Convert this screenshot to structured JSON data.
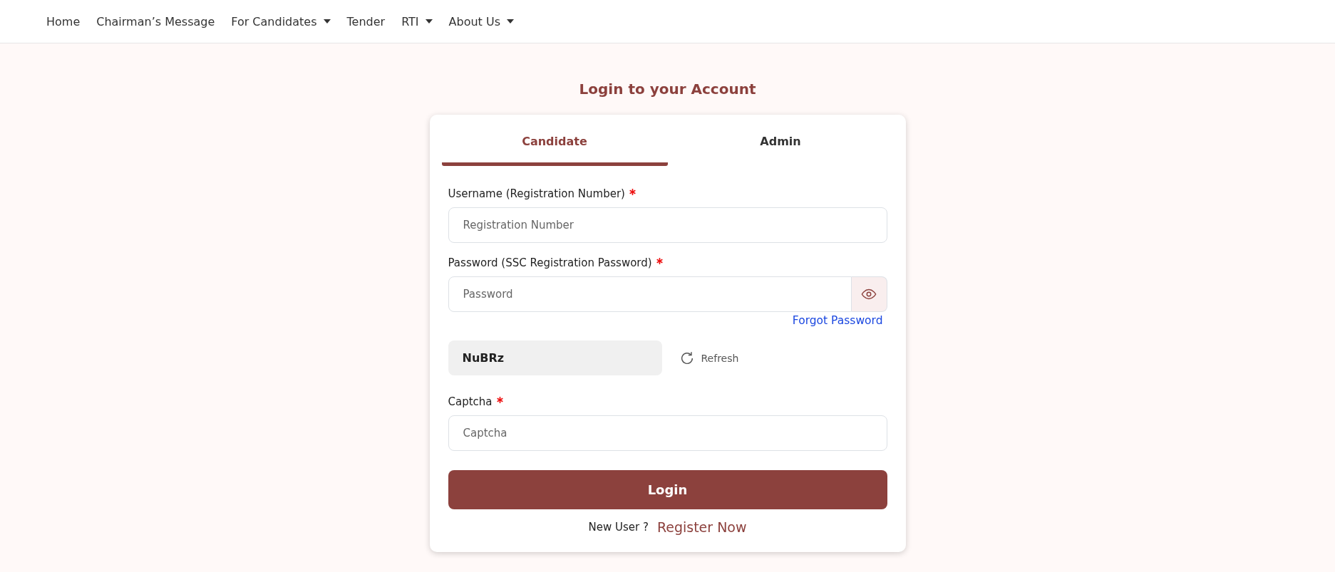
{
  "nav": [
    {
      "label": "Home",
      "dropdown": false
    },
    {
      "label": "Chairman’s Message",
      "dropdown": false
    },
    {
      "label": "For Candidates",
      "dropdown": true
    },
    {
      "label": "Tender",
      "dropdown": false
    },
    {
      "label": "RTI",
      "dropdown": true
    },
    {
      "label": "About Us",
      "dropdown": true
    }
  ],
  "title": "Login to your Account",
  "tabs": [
    {
      "label": "Candidate",
      "selected": true
    },
    {
      "label": "Admin",
      "selected": false
    }
  ],
  "fields": [
    {
      "kind": "text",
      "label": "Username (Registration Number)",
      "required": true,
      "placeholder": "Registration Number"
    },
    {
      "kind": "password",
      "label": "Password (SSC Registration Password)",
      "required": true,
      "placeholder": "Password",
      "link": "Forgot Password"
    },
    {
      "kind": "captcha",
      "code": "NuBRz",
      "action": "Refresh"
    },
    {
      "kind": "text",
      "label": "Captcha",
      "required": true,
      "placeholder": "Captcha"
    }
  ],
  "submit": "Login",
  "footer": {
    "text": "New User ?",
    "link": "Register Now"
  }
}
